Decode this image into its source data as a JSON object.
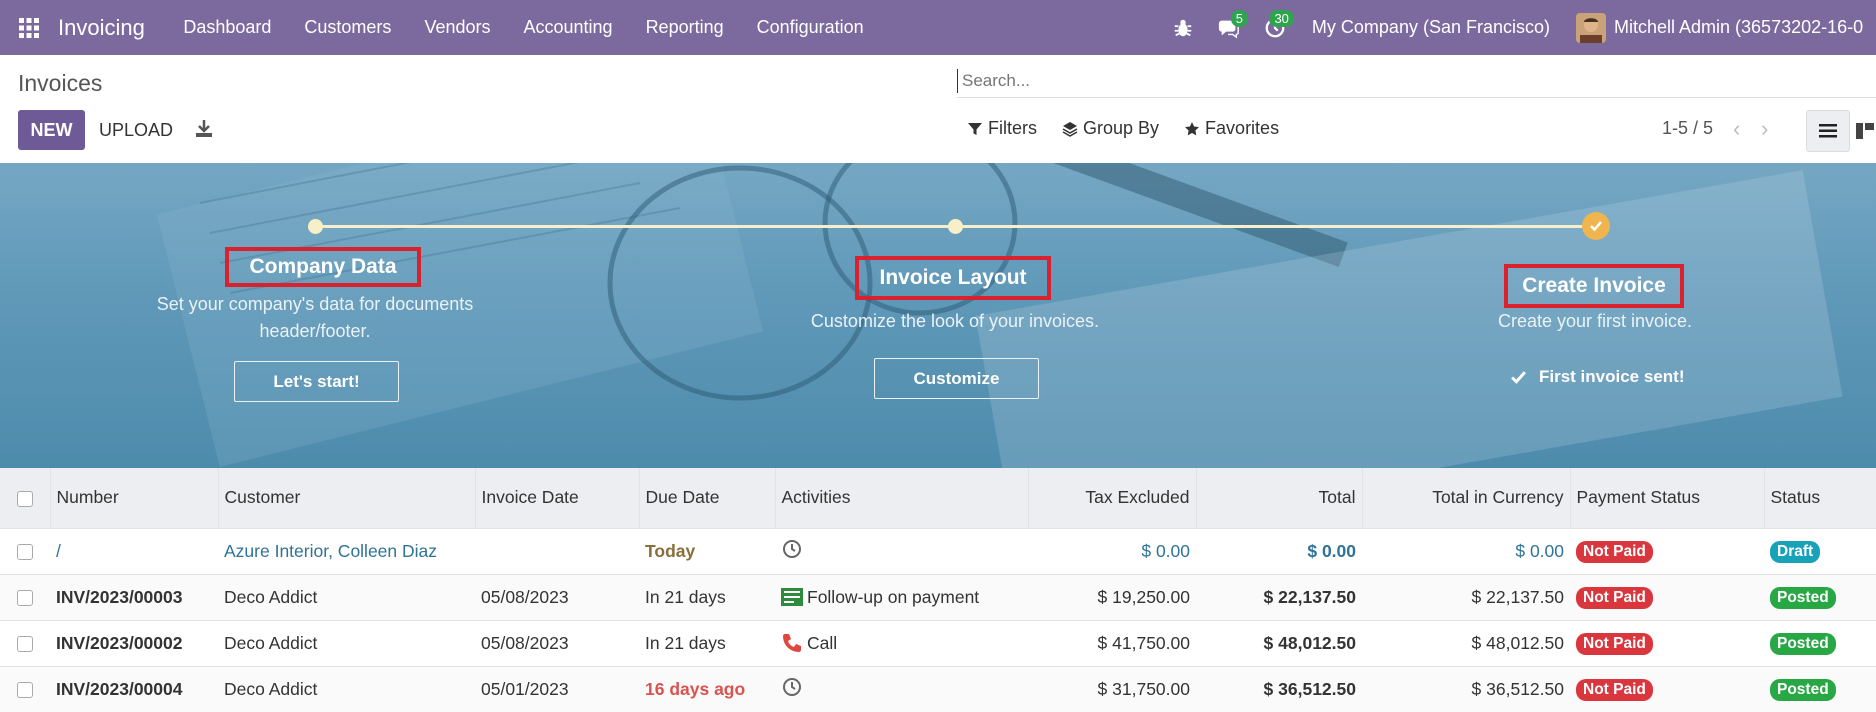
{
  "navbar": {
    "app_name": "Invoicing",
    "menu": [
      "Dashboard",
      "Customers",
      "Vendors",
      "Accounting",
      "Reporting",
      "Configuration"
    ],
    "messages_count": "5",
    "activities_count": "30",
    "company": "My Company (San Francisco)",
    "user": "Mitchell Admin (36573202-16-0"
  },
  "control": {
    "title": "Invoices",
    "search_placeholder": "Search...",
    "new_label": "NEW",
    "upload_label": "UPLOAD",
    "filters_label": "Filters",
    "groupby_label": "Group By",
    "favorites_label": "Favorites",
    "pager": "1-5 / 5"
  },
  "banner": {
    "steps": [
      {
        "title": "Company Data",
        "desc_line1": "Set your company's data for documents",
        "desc_line2": "header/footer.",
        "button": "Let's start!"
      },
      {
        "title": "Invoice Layout",
        "desc": "Customize the look of your invoices.",
        "button": "Customize"
      },
      {
        "title": "Create Invoice",
        "desc": "Create your first invoice.",
        "done_text": "First invoice sent!"
      }
    ]
  },
  "table": {
    "headers": [
      "Number",
      "Customer",
      "Invoice Date",
      "Due Date",
      "Activities",
      "Tax Excluded",
      "Total",
      "Total in Currency",
      "Payment Status",
      "Status"
    ],
    "rows": [
      {
        "number": "/",
        "customer": "Azure Interior, Colleen Diaz",
        "invoice_date": "",
        "due_date": "Today",
        "activity": "",
        "tax_excluded": "$ 0.00",
        "total": "$ 0.00",
        "total_currency": "$ 0.00",
        "payment_status": "Not Paid",
        "status": "Draft"
      },
      {
        "number": "INV/2023/00003",
        "customer": "Deco Addict",
        "invoice_date": "05/08/2023",
        "due_date": "In 21 days",
        "activity": "Follow-up on payment",
        "tax_excluded": "$ 19,250.00",
        "total": "$ 22,137.50",
        "total_currency": "$ 22,137.50",
        "payment_status": "Not Paid",
        "status": "Posted"
      },
      {
        "number": "INV/2023/00002",
        "customer": "Deco Addict",
        "invoice_date": "05/08/2023",
        "due_date": "In 21 days",
        "activity": "Call",
        "tax_excluded": "$ 41,750.00",
        "total": "$ 48,012.50",
        "total_currency": "$ 48,012.50",
        "payment_status": "Not Paid",
        "status": "Posted"
      },
      {
        "number": "INV/2023/00004",
        "customer": "Deco Addict",
        "invoice_date": "05/01/2023",
        "due_date": "16 days ago",
        "activity": "",
        "tax_excluded": "$ 31,750.00",
        "total": "$ 36,512.50",
        "total_currency": "$ 36,512.50",
        "payment_status": "Not Paid",
        "status": "Posted"
      }
    ]
  },
  "colors": {
    "navbar": "#7c6a9f",
    "primary_button": "#6f5a98",
    "not_paid": "#d9363e",
    "draft": "#17a2b8",
    "posted": "#28a745",
    "today": "#8a6d3b",
    "overdue": "#d9534f",
    "highlight_box": "#d9222e"
  }
}
